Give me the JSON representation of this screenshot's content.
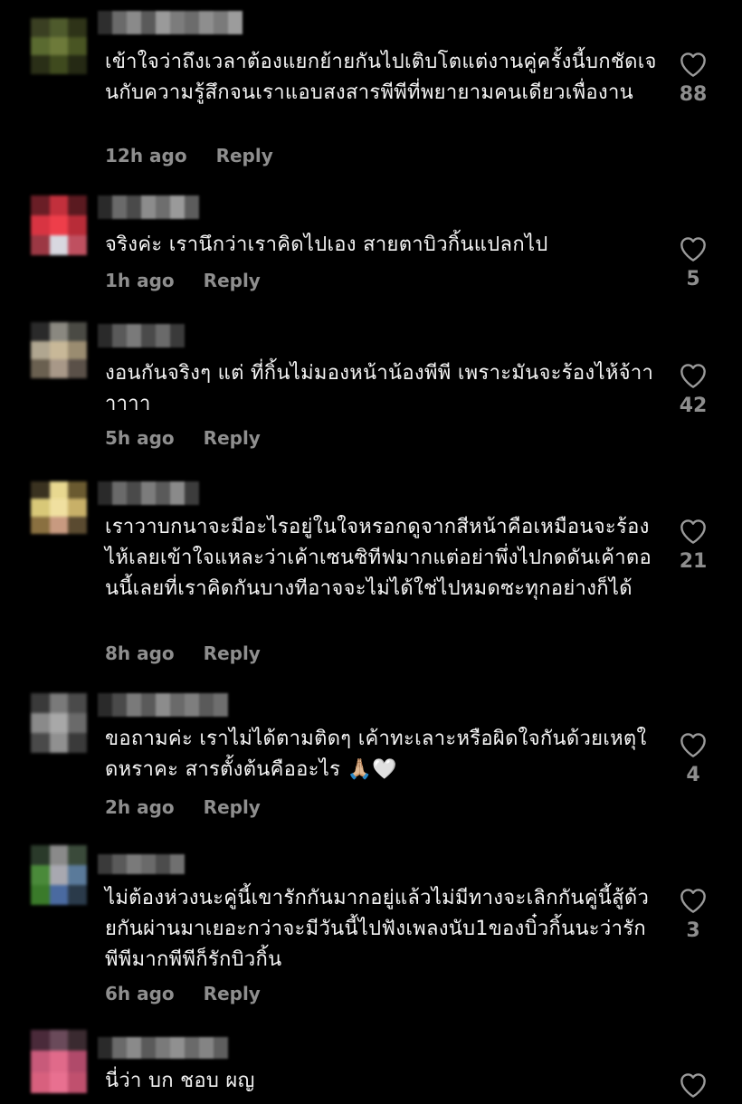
{
  "colors": {
    "background": "#000000",
    "text": "#f4f4f4",
    "muted": "#8e8e8e"
  },
  "comments": [
    {
      "text": "เข้าใจว่าถึงเวลาต้องแยกย้ายกันไปเติบโตแต่งานคู่ครั้งนี้บกชัดเจนกับความรู้สึกจนเราแอบสงสารพีพีที่พยายามคนเดียวเพื่องาน",
      "time": "12h ago",
      "reply": "Reply",
      "likes": "88",
      "heart_icon": "heart-outline-icon"
    },
    {
      "text": "จริงค่ะ เรานึกว่าเราคิดไปเอง สายตาบิวกิ้นแปลกไป",
      "time": "1h ago",
      "reply": "Reply",
      "likes": "5",
      "heart_icon": "heart-outline-icon"
    },
    {
      "text": "งอนกันจริงๆ แต่ ที่กิ้นไม่มองหน้าน้องพีพี เพราะมันจะร้องไห้จ้าาาาาา",
      "time": "5h ago",
      "reply": "Reply",
      "likes": "42",
      "heart_icon": "heart-outline-icon"
    },
    {
      "text": "เราวาบกนาจะมีอะไรอยู่ในใจหรอกดูจากสีหน้าคือเหมือนจะร้องไห้เลยเข้าใจแหละว่าเค้าเซนซิทีฟมากแต่อย่าพึ่งไปกดดันเค้าตอนนี้เลยที่เราคิดกันบางทีอาจจะไม่ได้ใช่ไปหมดซะทุกอย่างก็ได้",
      "time": "8h ago",
      "reply": "Reply",
      "likes": "21",
      "heart_icon": "heart-outline-icon"
    },
    {
      "text": "ขอถามค่ะ เราไม่ได้ตามติดๆ เค้าทะเลาะหรือผิดใจกันด้วยเหตุใดหราคะ สารตั้งต้นคืออะไร 🙏🏼🤍",
      "time": "2h ago",
      "reply": "Reply",
      "likes": "4",
      "heart_icon": "heart-outline-icon"
    },
    {
      "text": "ไม่ต้องห่วงนะคู่นี้เขารักกันมากอยู่แล้วไม่มีทางจะเลิกกันคู่นี้สู้ด้วยกันผ่านมาเยอะกว่าจะมีวันนี้ไปฟังเพลงนับ1ของบิ๋วกิ้นนะว่ารักพีพีมากพีพีก็รักบิวกิ้น",
      "time": "6h ago",
      "reply": "Reply",
      "likes": "3",
      "heart_icon": "heart-outline-icon"
    },
    {
      "text": "นี่ว่า บก ชอบ ผญ",
      "time": "",
      "reply": "",
      "likes": "",
      "heart_icon": "heart-outline-icon"
    }
  ]
}
